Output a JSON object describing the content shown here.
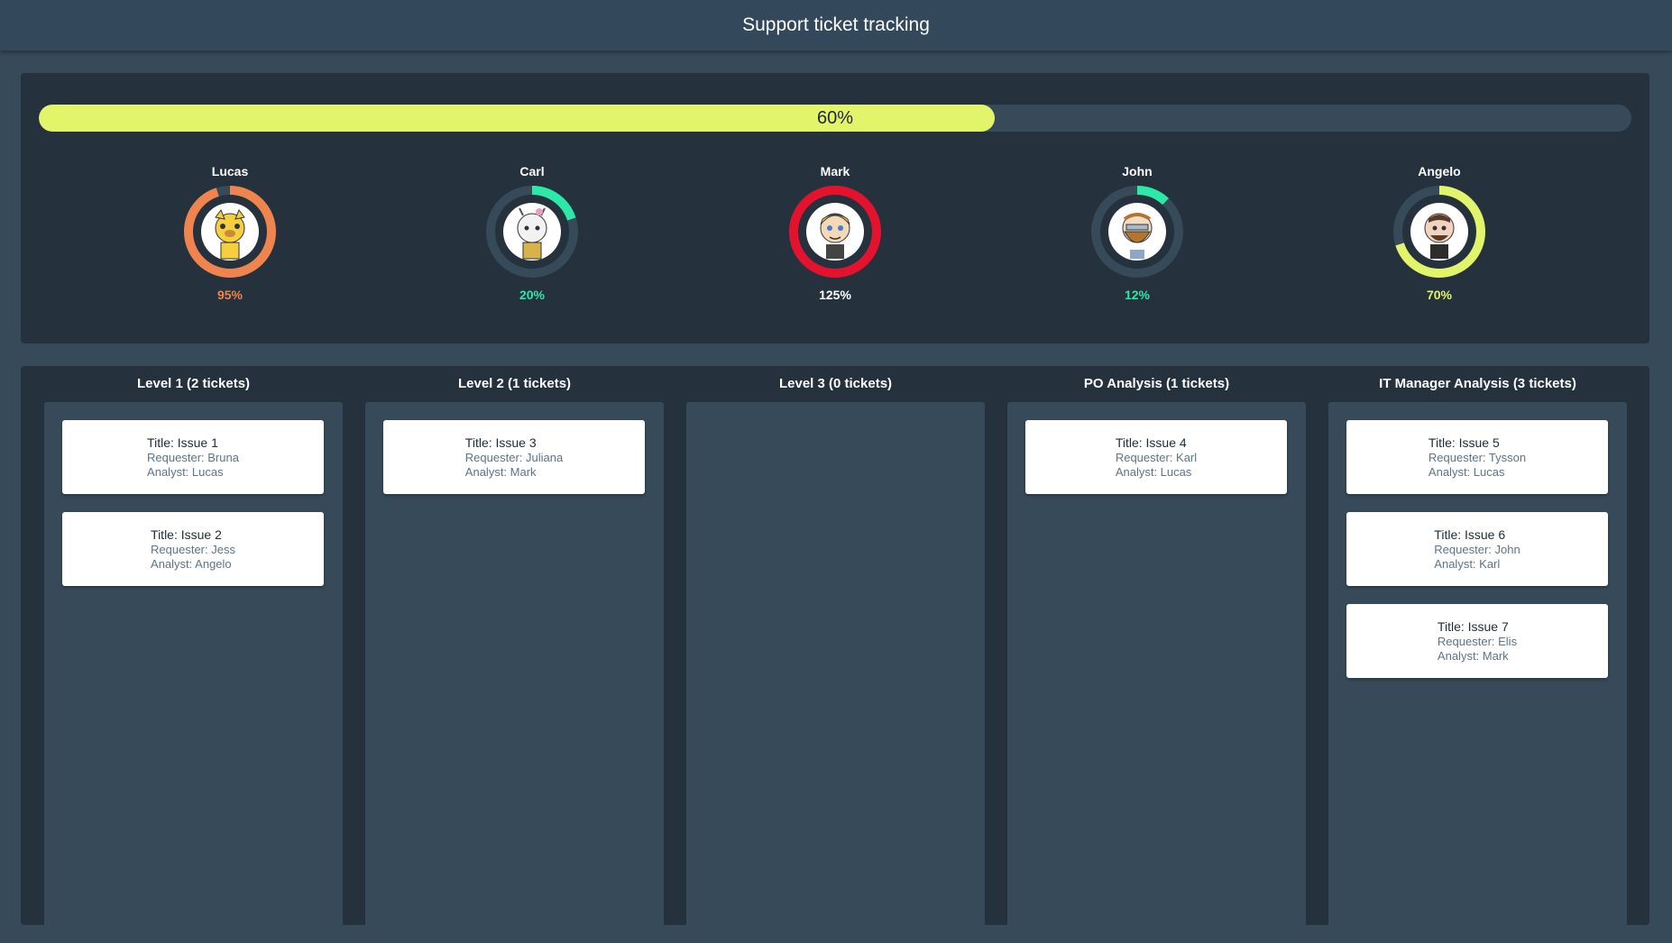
{
  "header": {
    "title": "Support ticket tracking"
  },
  "progress": {
    "label": "60%",
    "value": 60,
    "color": "#e2f56a"
  },
  "analysts": [
    {
      "name": "Lucas",
      "percent_label": "95%",
      "percent": 95,
      "color": "#f0844f",
      "avatar": "cat-avatar-icon"
    },
    {
      "name": "Carl",
      "percent_label": "20%",
      "percent": 20,
      "color": "#2ee8a8",
      "avatar": "goat-avatar-icon"
    },
    {
      "name": "Mark",
      "percent_label": "125%",
      "percent": 125,
      "color": "#e5122e",
      "avatar": "blonde-avatar-icon"
    },
    {
      "name": "John",
      "percent_label": "12%",
      "percent": 12,
      "color": "#2ee8a8",
      "avatar": "bearded-avatar-icon"
    },
    {
      "name": "Angelo",
      "percent_label": "70%",
      "percent": 70,
      "color": "#e2f56a",
      "avatar": "man-avatar-icon"
    }
  ],
  "columns": [
    {
      "title": "Level 1 (2 tickets)",
      "cards": [
        {
          "title": "Title: Issue 1",
          "requester": "Requester: Bruna",
          "analyst": "Analyst: Lucas"
        },
        {
          "title": "Title: Issue 2",
          "requester": "Requester: Jess",
          "analyst": "Analyst: Angelo"
        }
      ]
    },
    {
      "title": "Level 2 (1 tickets)",
      "cards": [
        {
          "title": "Title: Issue 3",
          "requester": "Requester: Juliana",
          "analyst": "Analyst: Mark"
        }
      ]
    },
    {
      "title": "Level 3 (0 tickets)",
      "cards": []
    },
    {
      "title": "PO Analysis (1 tickets)",
      "cards": [
        {
          "title": "Title: Issue 4",
          "requester": "Requester: Karl",
          "analyst": "Analyst: Lucas"
        }
      ]
    },
    {
      "title": "IT Manager Analysis (3 tickets)",
      "cards": [
        {
          "title": "Title: Issue 5",
          "requester": "Requester: Tysson",
          "analyst": "Analyst: Lucas"
        },
        {
          "title": "Title: Issue 6",
          "requester": "Requester: John",
          "analyst": "Analyst: Karl"
        },
        {
          "title": "Title: Issue 7",
          "requester": "Requester: Elis",
          "analyst": "Analyst: Mark"
        }
      ]
    }
  ]
}
